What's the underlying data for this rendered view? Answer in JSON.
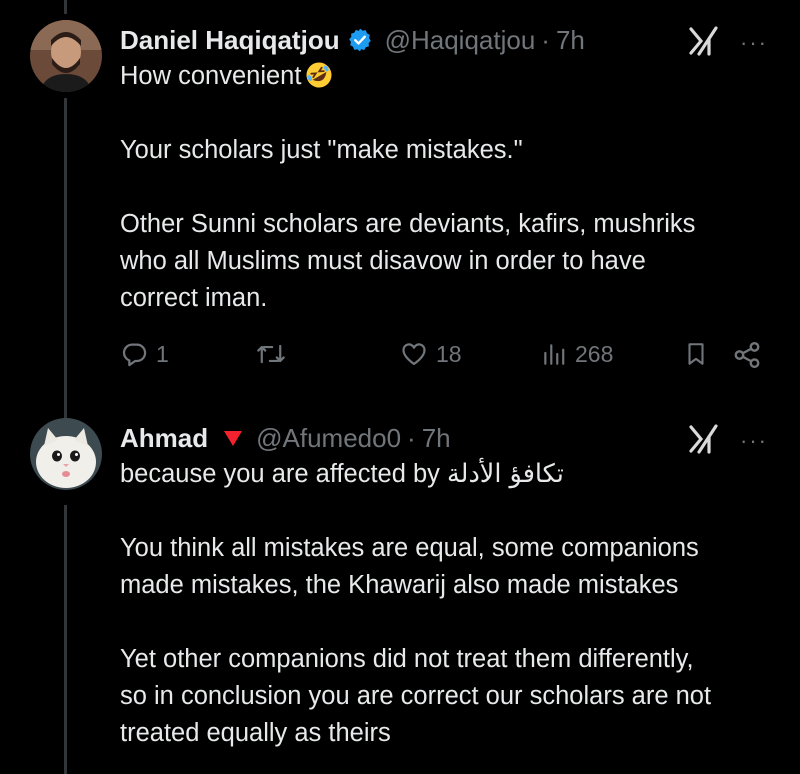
{
  "tweets": [
    {
      "display_name": "Daniel Haqiqatjou",
      "handle": "@Haqiqatjou",
      "separator": "·",
      "time": "7h",
      "verified": true,
      "more": "···",
      "lines": {
        "l1": "How convenient",
        "l2": "Your scholars just \"make mistakes.\"",
        "l3": "Other Sunni scholars are deviants, kafirs, mushriks",
        "l4": "who all Muslims must disavow in order to have",
        "l5": "correct iman."
      },
      "emoji": "rolling-on-floor-laughing-emoji",
      "actions": {
        "replies": "1",
        "reposts": "",
        "likes": "18",
        "views": "268"
      }
    },
    {
      "display_name": "Ahmad",
      "handle": "@Afumedo0",
      "separator": "·",
      "time": "7h",
      "flair": "red-triangle-icon",
      "more": "···",
      "lines": {
        "l1a": "because you are affected by ",
        "l1b": "تكافؤ الأدلة",
        "l2": "You think all mistakes are equal, some companions",
        "l3": "made mistakes, the Khawarij also made mistakes",
        "l4": "Yet other companions did not treat them differently,",
        "l5": "so in conclusion you are correct our scholars are not",
        "l6": "treated equally as theirs"
      }
    }
  ],
  "colors": {
    "background": "#000000",
    "text": "#e7e9ea",
    "muted": "#71767b",
    "verified": "#1d9bf0",
    "flair": "#f4212e",
    "thread_line": "#333639"
  }
}
